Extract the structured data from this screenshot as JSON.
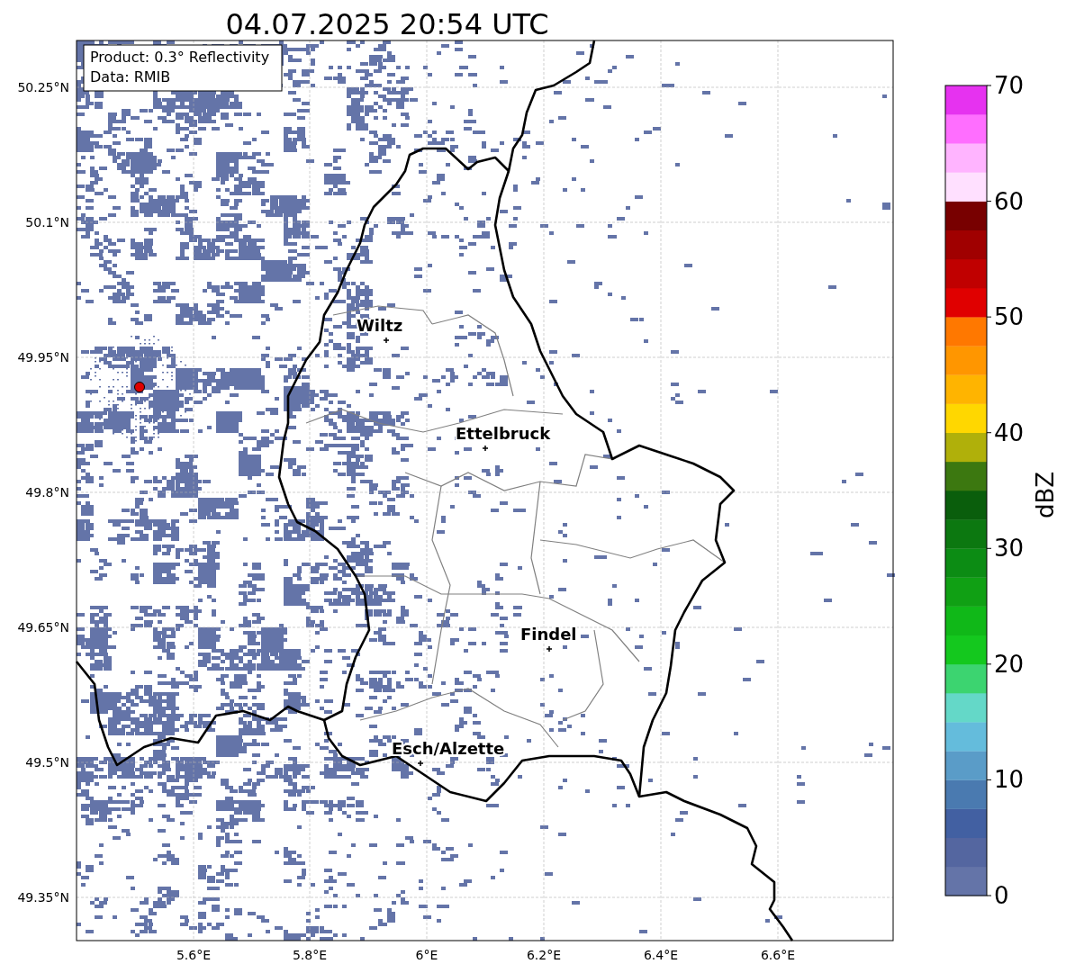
{
  "title": "04.07.2025 20:54 UTC",
  "legend": {
    "lines": [
      "Product: 0.3° Reflectivity",
      "Data: RMIB"
    ]
  },
  "map": {
    "y_ticks": [
      "50.25°N",
      "50.1°N",
      "49.95°N",
      "49.8°N",
      "49.65°N",
      "49.5°N",
      "49.35°N"
    ],
    "x_ticks": [
      "5.6°E",
      "5.8°E",
      "6°E",
      "6.2°E",
      "6.4°E",
      "6.6°E"
    ],
    "cities": [
      {
        "name": "Wiltz"
      },
      {
        "name": "Ettelbruck"
      },
      {
        "name": "Findel"
      },
      {
        "name": "Esch/Alzette"
      }
    ]
  },
  "colorbar": {
    "label": "dBZ",
    "ticks": [
      "70",
      "60",
      "50",
      "40",
      "30",
      "20",
      "10",
      "0"
    ],
    "bands": [
      {
        "color": "#6474a8"
      },
      {
        "color": "#5466a0"
      },
      {
        "color": "#4260a2"
      },
      {
        "color": "#4a7ab0"
      },
      {
        "color": "#5a9cc8"
      },
      {
        "color": "#64bcdc"
      },
      {
        "color": "#64d8c8"
      },
      {
        "color": "#3cd470"
      },
      {
        "color": "#14c81e"
      },
      {
        "color": "#10b818"
      },
      {
        "color": "#10a014"
      },
      {
        "color": "#0c8c14"
      },
      {
        "color": "#0c7810"
      },
      {
        "color": "#0a5e0c"
      },
      {
        "color": "#3c7810"
      },
      {
        "color": "#b0b00a"
      },
      {
        "color": "#ffd700"
      },
      {
        "color": "#ffb400"
      },
      {
        "color": "#ff9600"
      },
      {
        "color": "#ff7800"
      },
      {
        "color": "#e00000"
      },
      {
        "color": "#c00000"
      },
      {
        "color": "#a00000"
      },
      {
        "color": "#780000"
      },
      {
        "color": "#ffe0ff"
      },
      {
        "color": "#ffb4ff"
      },
      {
        "color": "#ff6eff"
      },
      {
        "color": "#e632f0"
      }
    ]
  }
}
